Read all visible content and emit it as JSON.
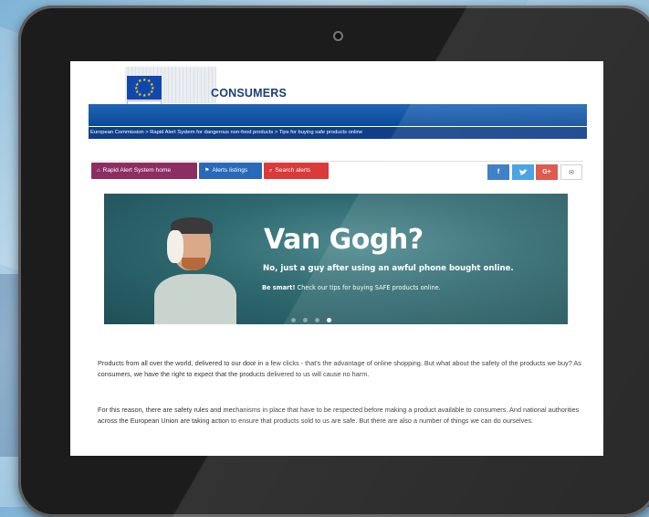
{
  "header": {
    "eu_logo_caption": "European Commission",
    "site_title": "CONSUMERS"
  },
  "breadcrumb": "European Commission > Rapid Alert System for dangerous non-food products > Tips for buying safe products online",
  "nav": {
    "home_label": "Rapid Alert System home",
    "alerts_label": "Alerts listings",
    "search_label": "Search alerts"
  },
  "social": {
    "facebook": "f",
    "twitter": "✓",
    "googleplus": "G+",
    "email": "✉"
  },
  "banner": {
    "title": "Van Gogh?",
    "subtitle": "No, just a guy after using an awful phone bought online.",
    "cta_bold": "Be smart!",
    "cta_rest": " Check our tips for buying SAFE products online.",
    "slides": 4,
    "active_slide": 4
  },
  "content": {
    "paragraph1": "Products from all over the world, delivered to our door in a few clicks - that's the advantage of online shopping. But what about the safety of the products we buy? As consumers, we have the right to expect that the products delivered to us will cause no harm.",
    "paragraph2": "For this reason, there are safety rules and mechanisms in place that have to be respected before making a product available to consumers. And national authorities across the European Union are taking action to ensure that products sold to us are safe. But there are also a number of things we can do ourselves."
  },
  "colors": {
    "home_button": "#8d2e63",
    "alerts_button": "#2869b8",
    "search_button": "#d93a3a",
    "header_blue": "#0b4a99"
  }
}
